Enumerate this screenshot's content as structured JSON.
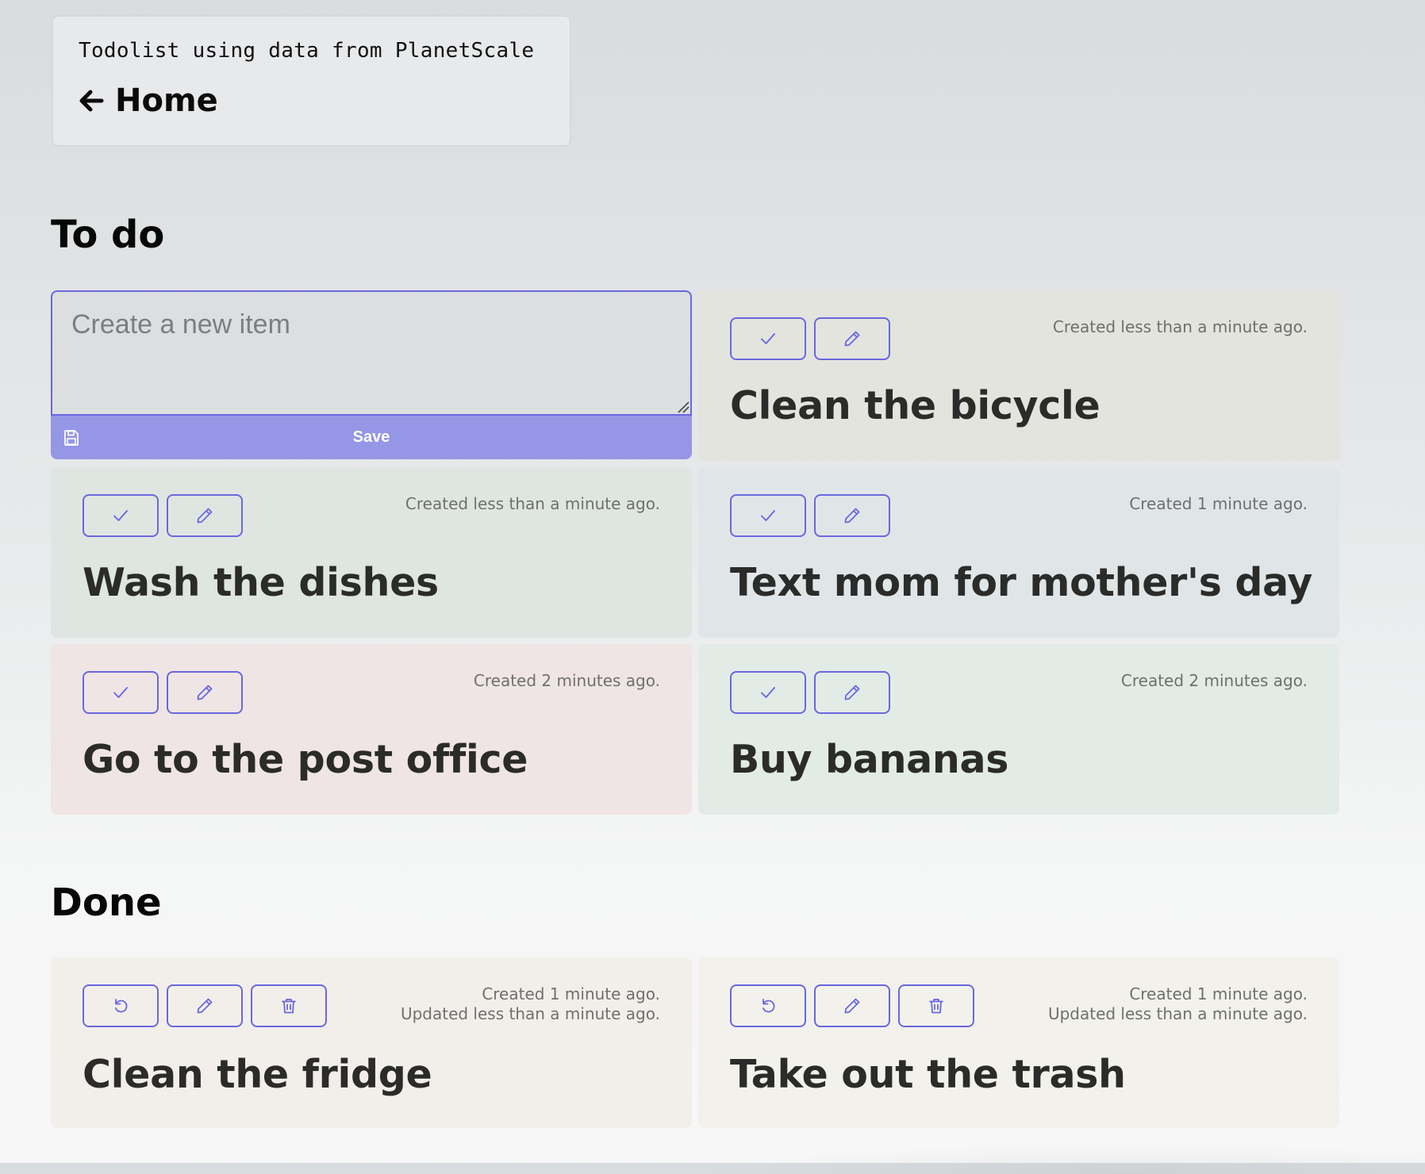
{
  "header": {
    "subtitle": "Todolist using data from PlanetScale",
    "home_label": "Home"
  },
  "todo_section": {
    "title": "To do",
    "new_item": {
      "placeholder": "Create a new item",
      "value": "",
      "save_label": "Save"
    },
    "items": [
      {
        "title": "Clean the bicycle",
        "created": "Created less than a minute ago.",
        "bg": "#e3e4de"
      },
      {
        "title": "Wash the dishes",
        "created": "Created less than a minute ago.",
        "bg": "#dfe6e2"
      },
      {
        "title": "Text mom for mother's day",
        "created": "Created 1 minute ago.",
        "bg": "#e0e6e8"
      },
      {
        "title": "Go to the post office",
        "created": "Created 2 minutes ago.",
        "bg": "#efe5e4"
      },
      {
        "title": "Buy bananas",
        "created": "Created 2 minutes ago.",
        "bg": "#e3ebe7"
      }
    ]
  },
  "done_section": {
    "title": "Done",
    "items": [
      {
        "title": "Clean the fridge",
        "created": "Created 1 minute ago.",
        "updated": "Updated less than a minute ago.",
        "bg": "#f2efeb"
      },
      {
        "title": "Take out the trash",
        "created": "Created 1 minute ago.",
        "updated": "Updated less than a minute ago.",
        "bg": "#f2f1ec"
      }
    ]
  },
  "icons": {
    "home": "arrow-left-icon",
    "save": "save-icon",
    "complete": "check-icon",
    "edit": "pencil-icon",
    "restore": "undo-icon",
    "delete": "trash-icon"
  },
  "colors": {
    "accent": "#6a67df",
    "save_button": "#9696e6"
  }
}
